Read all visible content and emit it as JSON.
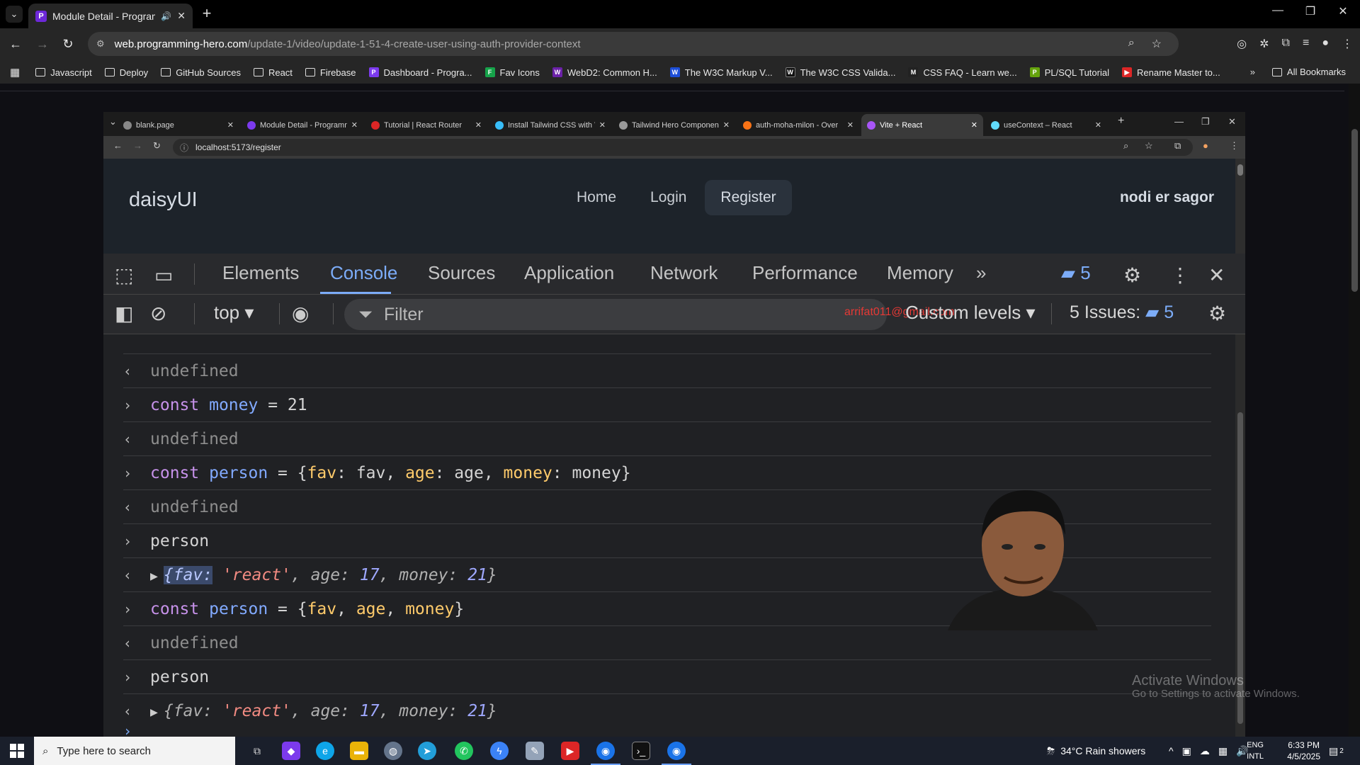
{
  "browser": {
    "active_tab": {
      "title": "Module Detail - Programm",
      "favicon": "P"
    },
    "url_host": "web.programming-hero.com",
    "url_path": "/update-1/video/update-1-51-4-create-user-using-auth-provider-context",
    "bookmarks": [
      {
        "label": "Javascript",
        "icon": "folder-icon"
      },
      {
        "label": "Deploy",
        "icon": "folder-icon"
      },
      {
        "label": "GitHub Sources",
        "icon": "folder-icon"
      },
      {
        "label": "React",
        "icon": "folder-icon"
      },
      {
        "label": "Firebase",
        "icon": "folder-icon"
      },
      {
        "label": "Dashboard - Progra...",
        "icon": "P",
        "color": "#7c3aed"
      },
      {
        "label": "Fav Icons",
        "icon": "F",
        "color": "#16a34a"
      },
      {
        "label": "WebD2: Common H...",
        "icon": "W",
        "color": "#6b21a8"
      },
      {
        "label": "The W3C Markup V...",
        "icon": "W",
        "color": "#1d4ed8"
      },
      {
        "label": "The W3C CSS Valida...",
        "icon": "W",
        "color": "#111111"
      },
      {
        "label": "CSS FAQ - Learn we...",
        "icon": "M",
        "color": "#222222"
      },
      {
        "label": "PL/SQL Tutorial",
        "icon": "P",
        "color": "#65a30d"
      },
      {
        "label": "Rename Master to...",
        "icon": "▶",
        "color": "#dc2626"
      }
    ],
    "all_bookmarks": "All Bookmarks"
  },
  "inner_browser": {
    "tabs": [
      {
        "title": "blank.page",
        "color": "#888888"
      },
      {
        "title": "Module Detail - Programm",
        "color": "#7c3aed"
      },
      {
        "title": "Tutorial | React Router",
        "color": "#dc2626"
      },
      {
        "title": "Install Tailwind CSS with V",
        "color": "#38bdf8"
      },
      {
        "title": "Tailwind Hero Componen",
        "color": "#999999"
      },
      {
        "title": "auth-moha-milon - Over",
        "color": "#f97316"
      },
      {
        "title": "Vite + React",
        "color": "#a855f7"
      },
      {
        "title": "useContext – React",
        "color": "#61dafb"
      }
    ],
    "active_index": 6,
    "url": "localhost:5173/register"
  },
  "app": {
    "logo": "daisyUI",
    "nav": [
      "Home",
      "Login",
      "Register"
    ],
    "selected_nav": "Register",
    "right_text": "nodi er sagor"
  },
  "devtools": {
    "tabs": [
      "Elements",
      "Console",
      "Sources",
      "Application",
      "Network",
      "Performance",
      "Memory"
    ],
    "selected_tab": "Console",
    "message_count": "5",
    "context": "top",
    "filter_placeholder": "Filter",
    "overlay_email": "arrifat011@gmail.com",
    "levels": "Custom levels",
    "issues_label": "5 Issues:",
    "issues_count": "5"
  },
  "console": {
    "rows": [
      {
        "kind": "result",
        "text": "undefined"
      },
      {
        "kind": "input",
        "text": "const money = 21"
      },
      {
        "kind": "result",
        "text": "undefined"
      },
      {
        "kind": "input",
        "text": "const person = {fav: fav, age: age, money: money}"
      },
      {
        "kind": "result",
        "text": "undefined"
      },
      {
        "kind": "input",
        "text": "person"
      },
      {
        "kind": "object",
        "text": "{fav: 'react', age: 17, money: 21}"
      },
      {
        "kind": "input",
        "text": "const person = {fav, age, money}"
      },
      {
        "kind": "result",
        "text": "undefined"
      },
      {
        "kind": "input",
        "text": "person"
      },
      {
        "kind": "object",
        "text": "{fav: 'react', age: 17, money: 21}"
      }
    ]
  },
  "watermark": {
    "line1": "Activate Windows",
    "line2": "Go to Settings to activate Windows."
  },
  "taskbar": {
    "search_placeholder": "Type here to search",
    "weather": "34°C  Rain showers",
    "lang1": "ENG",
    "lang2": "INTL",
    "time": "6:33 PM",
    "date": "4/5/2025",
    "notification_count": "2"
  }
}
